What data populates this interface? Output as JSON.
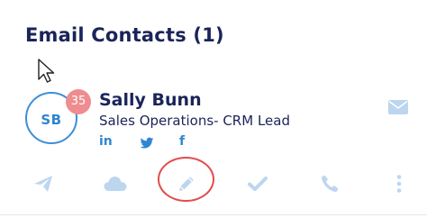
{
  "header": {
    "title": "Email Contacts (1)"
  },
  "contact": {
    "initials": "SB",
    "badge_count": "35",
    "name": "Sally Bunn",
    "role": "Sales Operations- CRM Lead",
    "social": {
      "linkedin": "in",
      "facebook": "f"
    },
    "icons": {
      "twitter": "twitter-icon",
      "mail": "envelope-icon"
    }
  },
  "actions": [
    {
      "icon": "send-icon"
    },
    {
      "icon": "cloud-icon"
    },
    {
      "icon": "pencil-icon",
      "highlighted": true
    },
    {
      "icon": "checkmark-icon"
    },
    {
      "icon": "phone-icon"
    },
    {
      "icon": "more-vertical-icon"
    }
  ],
  "colors": {
    "title": "#1b2459",
    "accent": "#2f86d0",
    "action_icon": "#bcd6f0",
    "badge": "#ef8c8f",
    "highlight": "#e24c4c"
  }
}
